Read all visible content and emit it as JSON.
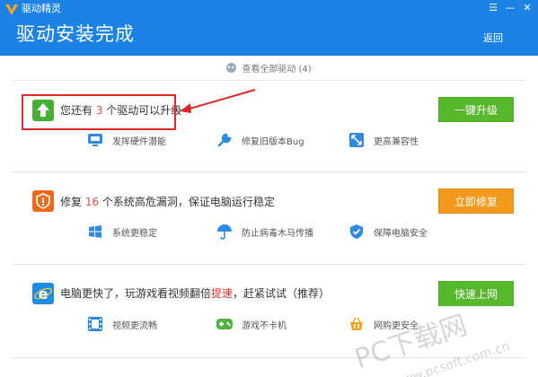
{
  "header": {
    "app_name": "驱动精灵",
    "title": "驱动安装完成",
    "back_label": "返回",
    "controls": {
      "menu": "☰",
      "minimize": "—",
      "close": "✕"
    }
  },
  "view_all": {
    "label": "查看全部驱动 (4)"
  },
  "upgrade": {
    "title_prefix": "您还有 ",
    "count": "3",
    "title_suffix": " 个驱动可以升级",
    "button": "一键升级",
    "features": [
      "发挥硬件潜能",
      "修复旧版本Bug",
      "更高兼容性"
    ]
  },
  "repair": {
    "title_prefix": "修复 ",
    "count": "16",
    "title_suffix": " 个系统高危漏洞，保证电脑运行稳定",
    "button": "立即修复",
    "features": [
      "系统更稳定",
      "防止病毒木马传播",
      "保障电脑安全"
    ]
  },
  "speed": {
    "title_prefix": "电脑更快了，玩游戏看视频翻倍",
    "highlight": "提速",
    "title_suffix": "，赶紧试试（推荐）",
    "button": "快速上网",
    "features": [
      "视频更流畅",
      "游戏不卡机",
      "网购更安全"
    ]
  },
  "watermark": {
    "text": "PC下载网",
    "url": "www.pcsoft.com.cn"
  },
  "colors": {
    "header": "#1c83e4",
    "green": "#58b82c",
    "orange": "#f39a1c",
    "highlight": "#e02828"
  }
}
